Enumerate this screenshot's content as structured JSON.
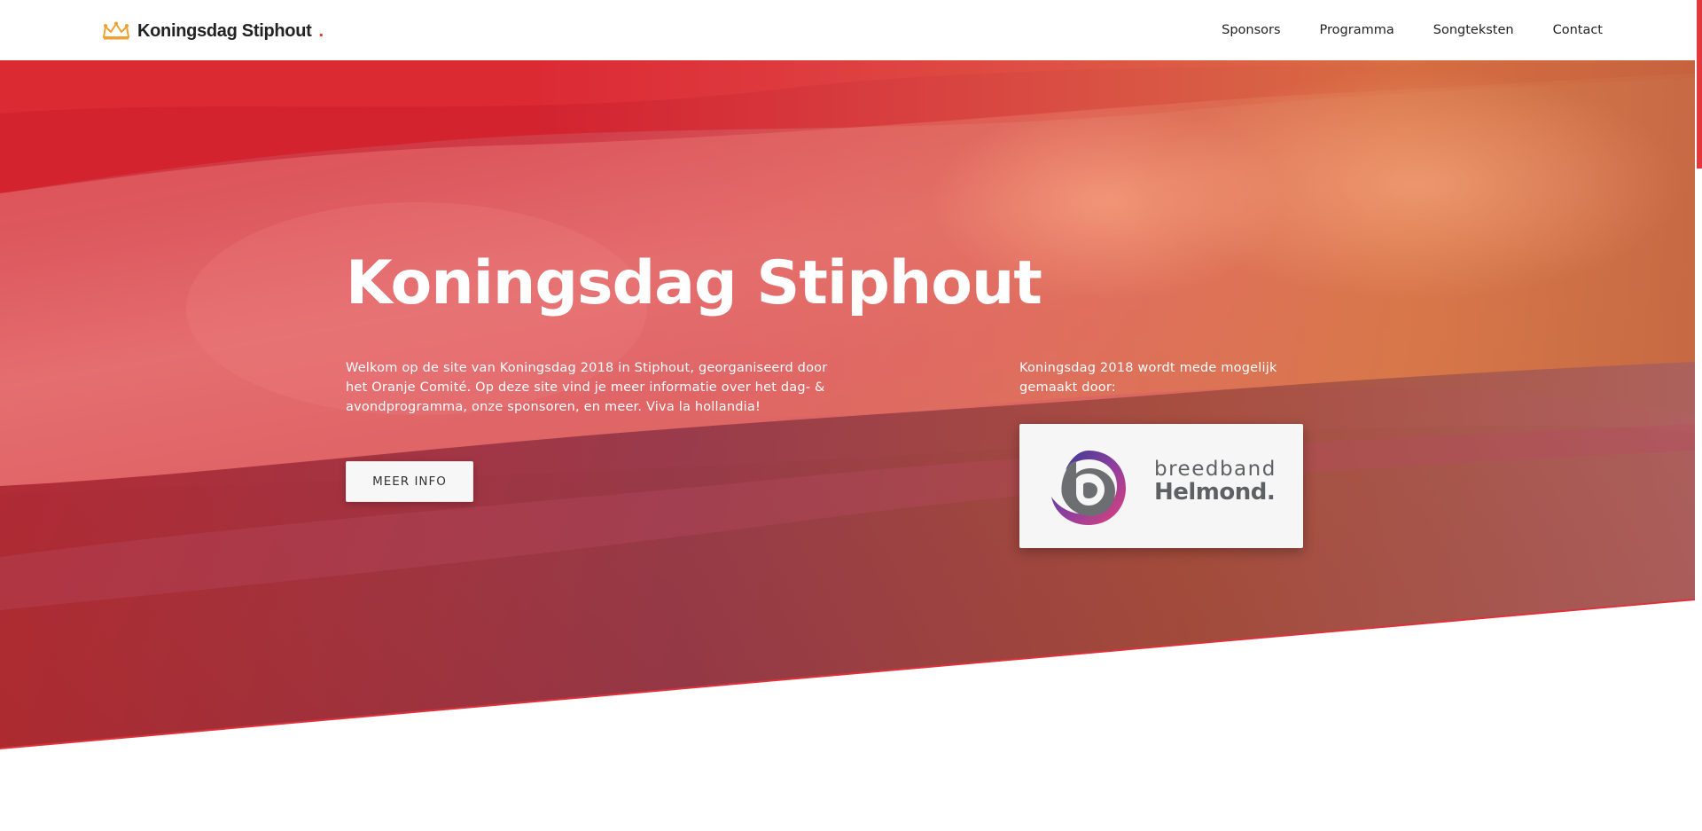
{
  "header": {
    "brand": "Koningsdag Stiphout",
    "brand_suffix": ".",
    "logo_icon": "crown-icon",
    "nav": [
      "Sponsors",
      "Programma",
      "Songteksten",
      "Contact"
    ]
  },
  "hero": {
    "title": "Koningsdag Stiphout",
    "intro": "Welkom op de site van Koningsdag 2018 in Stiphout, georganiseerd door het Oranje Comité. Op deze site vind je meer informatie over het dag- & avondprogramma, onze sponsoren, en meer. Viva la hollandia!",
    "button": "MEER INFO",
    "sponsor_text": "Koningsdag 2018 wordt mede mogelijk gemaakt door:",
    "sponsor_logo": {
      "line1": "breedband",
      "line2": "Helmond."
    }
  },
  "colors": {
    "accent": "#e3373c",
    "crown": "#f0a030",
    "text_dark": "#222222",
    "white": "#ffffff"
  }
}
